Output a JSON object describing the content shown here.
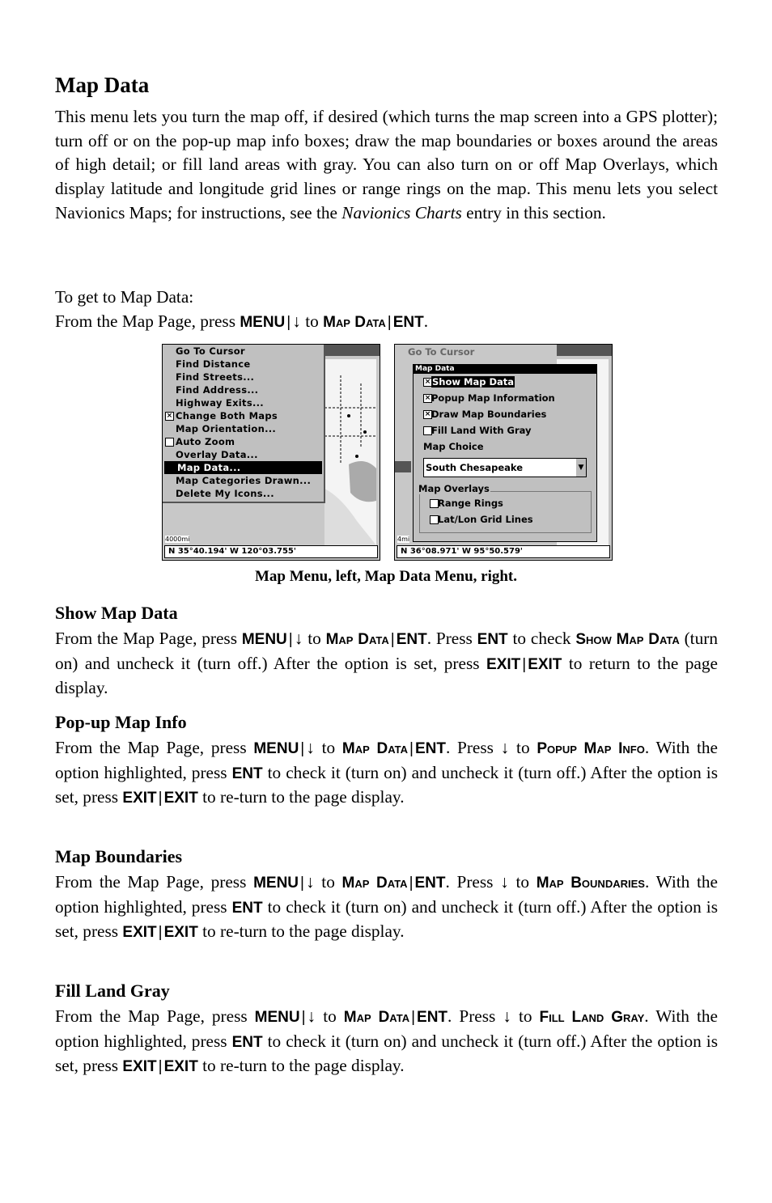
{
  "title": "Map Data",
  "intro": [
    {
      "t": "This menu lets you turn the map off, if desired (which turns the map screen into a GPS plotter); turn off or on the pop-up map info boxes; draw the map boundaries or boxes around the areas of high detail; or fill land areas with gray. You can also turn on or off Map Overlays, which display latitude and longitude grid lines or range rings on the map. This menu lets you select Navionics Maps; for instructions, see the "
    },
    {
      "t": "Navionics Charts",
      "s": "i"
    },
    {
      "t": " entry in this section."
    }
  ],
  "howto": [
    {
      "t": "To get to Map Data:"
    },
    {
      "br": true
    },
    {
      "t": "From the Map Page, press "
    },
    {
      "t": "MENU",
      "s": "k"
    },
    {
      "t": "|",
      "s": "sep"
    },
    {
      "t": "↓"
    },
    {
      "t": " to "
    },
    {
      "t": "Map Data",
      "s": "sc"
    },
    {
      "t": "|",
      "s": "sep"
    },
    {
      "t": "ENT",
      "s": "k"
    },
    {
      "t": "."
    }
  ],
  "left_screen": {
    "menu_items": [
      {
        "label": "Go To Cursor"
      },
      {
        "label": "Find Distance"
      },
      {
        "label": "Find Streets..."
      },
      {
        "label": "Find Address..."
      },
      {
        "label": "Highway Exits..."
      },
      {
        "label": "Change Both Maps",
        "check": "checked"
      },
      {
        "label": "Map Orientation..."
      },
      {
        "label": "Auto Zoom",
        "check": "unchecked"
      },
      {
        "label": "Overlay Data..."
      },
      {
        "label": "Map Data...",
        "selected": true
      },
      {
        "label": "Map Categories Drawn..."
      },
      {
        "label": "Delete My Icons..."
      }
    ],
    "scale": "4000mi",
    "status": "N   35°40.194'   W  120°03.755'"
  },
  "right_screen": {
    "bg_item": "Go To Cursor",
    "dialog_title": "Map Data",
    "options": [
      {
        "label": "Show Map Data",
        "checked": true,
        "highlighted": true
      },
      {
        "label": "Popup Map Information",
        "checked": true
      },
      {
        "label": "Draw Map Boundaries",
        "checked": true
      },
      {
        "label": "Fill Land With Gray",
        "checked": false
      }
    ],
    "map_choice_label": "Map Choice",
    "map_choice_value": "South Chesapeake",
    "overlays_label": "Map Overlays",
    "overlays": [
      {
        "label": "Range Rings",
        "checked": false
      },
      {
        "label": "Lat/Lon Grid Lines",
        "checked": false
      }
    ],
    "scale": "4mi",
    "status": "N   36°08.971'   W   95°50.579'"
  },
  "caption": "Map Menu, left, Map Data Menu, right.",
  "sections": [
    {
      "heading": "Show Map Data",
      "body": [
        {
          "t": "From the Map Page, press "
        },
        {
          "t": "MENU",
          "s": "k"
        },
        {
          "t": "|",
          "s": "sep"
        },
        {
          "t": "↓"
        },
        {
          "t": " to "
        },
        {
          "t": "Map Data",
          "s": "sc"
        },
        {
          "t": "|",
          "s": "sep"
        },
        {
          "t": "ENT",
          "s": "k"
        },
        {
          "t": ". Press "
        },
        {
          "t": "ENT",
          "s": "k"
        },
        {
          "t": " to check "
        },
        {
          "t": "Show Map Data",
          "s": "sc"
        },
        {
          "t": " (turn on) and uncheck it (turn off.) After the option is set, press "
        },
        {
          "t": "EXIT",
          "s": "k"
        },
        {
          "t": "|",
          "s": "sep"
        },
        {
          "t": "EXIT",
          "s": "k"
        },
        {
          "t": " to return to the page display."
        }
      ]
    },
    {
      "heading": "Pop-up Map Info",
      "body": [
        {
          "t": "From the Map Page, press "
        },
        {
          "t": "MENU",
          "s": "k"
        },
        {
          "t": "|",
          "s": "sep"
        },
        {
          "t": "↓"
        },
        {
          "t": " to "
        },
        {
          "t": "Map Data",
          "s": "sc"
        },
        {
          "t": "|",
          "s": "sep"
        },
        {
          "t": "ENT",
          "s": "k"
        },
        {
          "t": ". Press ↓ to "
        },
        {
          "t": "Popup Map Info",
          "s": "sc"
        },
        {
          "t": ". With the option highlighted, press "
        },
        {
          "t": "ENT",
          "s": "k"
        },
        {
          "t": " to check it (turn on) and uncheck it (turn off.) After the option is set, press "
        },
        {
          "t": "EXIT",
          "s": "k"
        },
        {
          "t": "|",
          "s": "sep"
        },
        {
          "t": "EXIT",
          "s": "k"
        },
        {
          "t": " to re-turn to the page display."
        }
      ]
    },
    {
      "heading": "Map Boundaries",
      "body": [
        {
          "t": "From the Map Page, press "
        },
        {
          "t": "MENU",
          "s": "k"
        },
        {
          "t": "|",
          "s": "sep"
        },
        {
          "t": "↓"
        },
        {
          "t": " to "
        },
        {
          "t": "Map Data",
          "s": "sc"
        },
        {
          "t": "|",
          "s": "sep"
        },
        {
          "t": "ENT",
          "s": "k"
        },
        {
          "t": ". Press ↓ to "
        },
        {
          "t": "Map Boundaries",
          "s": "sc"
        },
        {
          "t": ". With the option highlighted, press "
        },
        {
          "t": "ENT",
          "s": "k"
        },
        {
          "t": " to check it (turn on) and uncheck it (turn off.) After the option is set, press "
        },
        {
          "t": "EXIT",
          "s": "k"
        },
        {
          "t": "|",
          "s": "sep"
        },
        {
          "t": "EXIT",
          "s": "k"
        },
        {
          "t": " to re-turn to the page display."
        }
      ]
    },
    {
      "heading": "Fill Land Gray",
      "body": [
        {
          "t": "From the Map Page, press "
        },
        {
          "t": "MENU",
          "s": "k"
        },
        {
          "t": "|",
          "s": "sep"
        },
        {
          "t": "↓"
        },
        {
          "t": " to "
        },
        {
          "t": "Map Data",
          "s": "sc"
        },
        {
          "t": "|",
          "s": "sep"
        },
        {
          "t": "ENT",
          "s": "k"
        },
        {
          "t": ". Press ↓ to "
        },
        {
          "t": "Fill Land Gray",
          "s": "sc"
        },
        {
          "t": ". With the option highlighted, press "
        },
        {
          "t": "ENT",
          "s": "k"
        },
        {
          "t": " to check it (turn on) and uncheck it (turn off.) After the option is set, press "
        },
        {
          "t": "EXIT",
          "s": "k"
        },
        {
          "t": "|",
          "s": "sep"
        },
        {
          "t": "EXIT",
          "s": "k"
        },
        {
          "t": " to re-turn to the page display."
        }
      ]
    }
  ]
}
